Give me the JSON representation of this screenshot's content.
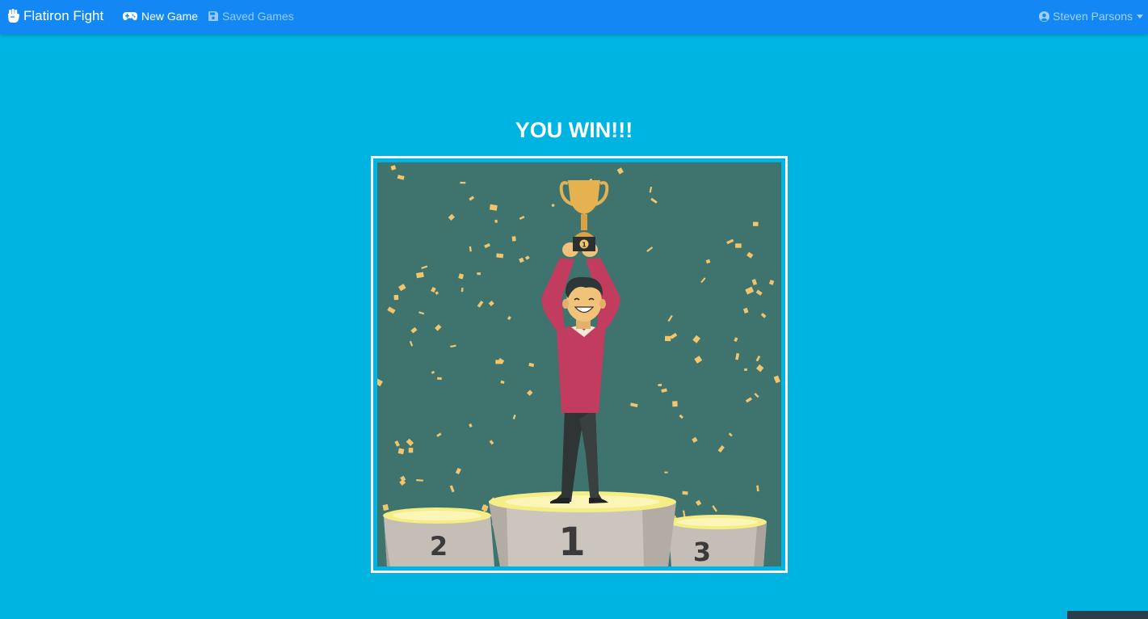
{
  "navbar": {
    "brand": "Flatiron Fight",
    "brand_icon": "raised-fist-icon",
    "links": [
      {
        "label": "New Game",
        "icon": "gamepad-icon",
        "active": true
      },
      {
        "label": "Saved Games",
        "icon": "floppy-disk-icon",
        "active": false
      }
    ],
    "user": {
      "name": "Steven Parsons",
      "icon": "user-circle-icon"
    }
  },
  "main": {
    "title": "YOU WIN!!!",
    "illustration": {
      "podium_labels": [
        "2",
        "1",
        "3"
      ]
    }
  },
  "colors": {
    "page_background": "#00b4e2",
    "navbar_background": "#1388f5",
    "illustration_background": "#3e736e",
    "confetti": "#f2c46b",
    "sweater": "#c13c5e",
    "trophy": "#e6b14f"
  }
}
